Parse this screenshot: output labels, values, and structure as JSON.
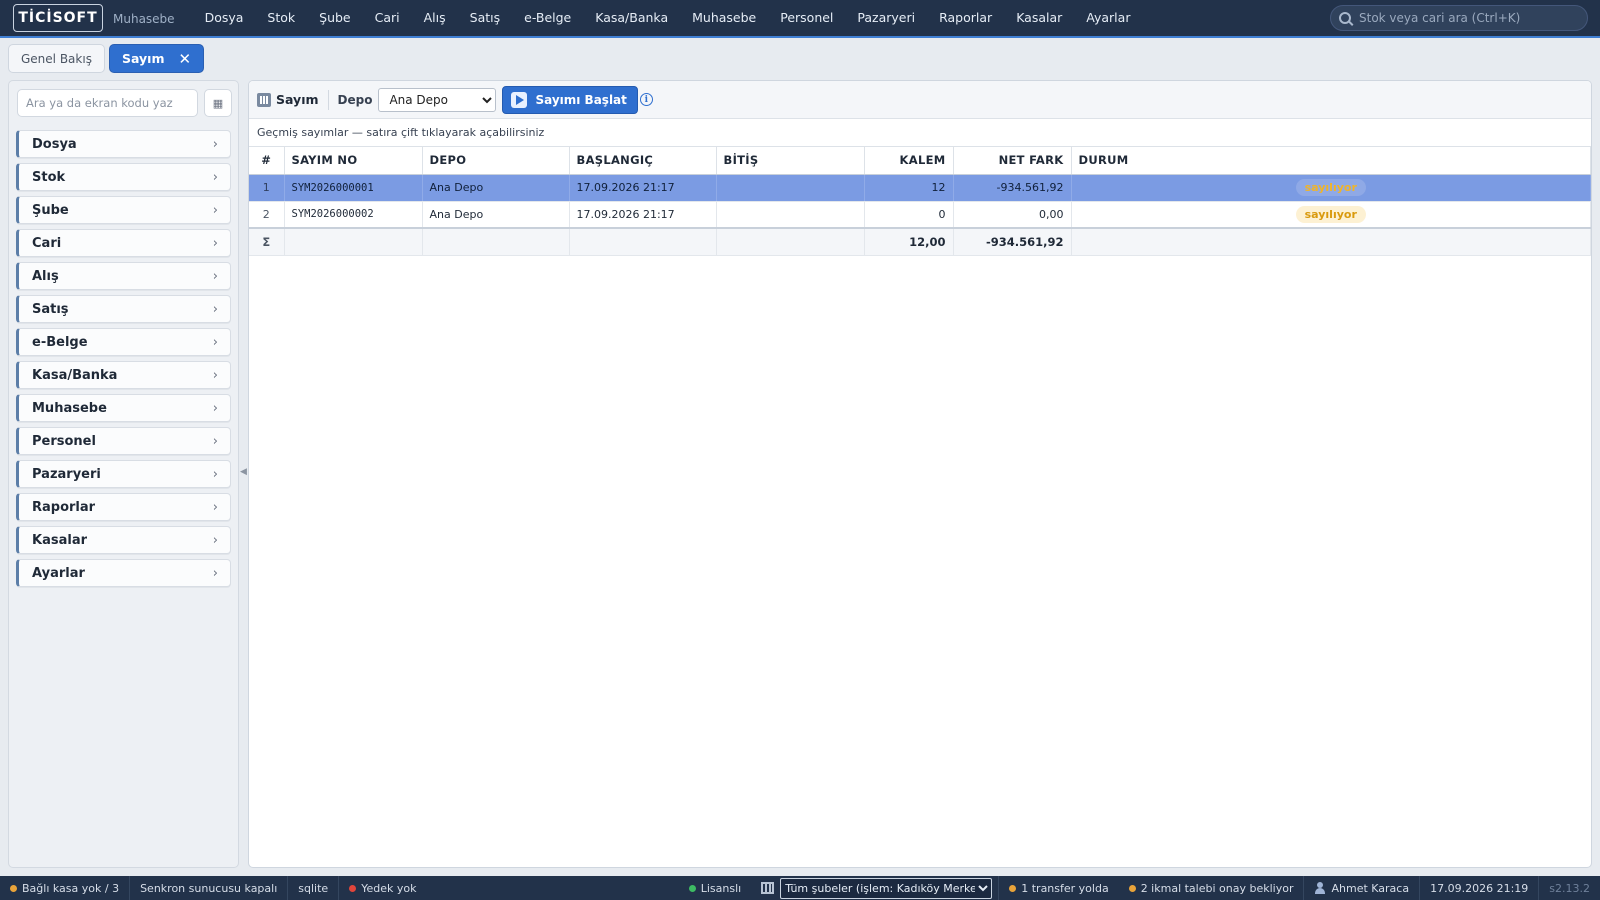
{
  "topbar": {
    "logo": "TİCİSOFT",
    "app_sub": "Muhasebe",
    "menu": [
      "Dosya",
      "Stok",
      "Şube",
      "Cari",
      "Alış",
      "Satış",
      "e-Belge",
      "Kasa/Banka",
      "Muhasebe",
      "Personel",
      "Pazaryeri",
      "Raporlar",
      "Kasalar",
      "Ayarlar"
    ],
    "search_placeholder": "Stok veya cari ara (Ctrl+K)"
  },
  "tabs": {
    "overview": "Genel Bakış",
    "active": "Sayım",
    "close": "✕"
  },
  "sidebar": {
    "search_placeholder": "Ara ya da ekran kodu yaz",
    "grid_btn": "▦",
    "items": [
      "Dosya",
      "Stok",
      "Şube",
      "Cari",
      "Alış",
      "Satış",
      "e-Belge",
      "Kasa/Banka",
      "Muhasebe",
      "Personel",
      "Pazaryeri",
      "Raporlar",
      "Kasalar",
      "Ayarlar"
    ],
    "chevron": "›",
    "collapse": "◀"
  },
  "toolbar": {
    "title": "Sayım",
    "depo_label": "Depo",
    "depo_selected": "Ana Depo",
    "start_label": "Sayımı Başlat",
    "info": "i"
  },
  "hint": "Geçmiş sayımlar — satıra çift tıklayarak açabilirsiniz",
  "table": {
    "columns": [
      "#",
      "SAYIM NO",
      "DEPO",
      "BAŞLANGIÇ",
      "BİTİŞ",
      "KALEM",
      "NET FARK",
      "DURUM"
    ],
    "rows": [
      {
        "idx": "1",
        "no": "SYM2026000001",
        "depo": "Ana Depo",
        "start": "17.09.2026 21:17",
        "end": "",
        "kalem": "12",
        "net": "-934.561,92",
        "status": "sayılıyor"
      },
      {
        "idx": "2",
        "no": "SYM2026000002",
        "depo": "Ana Depo",
        "start": "17.09.2026 21:17",
        "end": "",
        "kalem": "0",
        "net": "0,00",
        "status": "sayılıyor"
      }
    ],
    "total": {
      "sigma": "Σ",
      "kalem": "12,00",
      "net": "-934.561,92"
    }
  },
  "statusbar": {
    "kasa": "Bağlı kasa yok / 3",
    "sync": "Senkron sunucusu kapalı",
    "db": "sqlite",
    "backup": "Yedek yok",
    "license": "Lisanslı",
    "branch_selected": "Tüm şubeler (işlem: Kadıköy Merkez)",
    "transfer": "1 transfer yolda",
    "ikmal": "2 ikmal talebi onay bekliyor",
    "user": "Ahmet Karaca",
    "datetime": "17.09.2026 21:19",
    "version": "s2.13.2"
  },
  "colors": {
    "topbar": "#22324a",
    "accent": "#2f6fcf",
    "selected_row": "#7b9be3",
    "status_warn": "#d99a0e",
    "dot_orange": "#e8a33a",
    "dot_red": "#e0453b",
    "dot_green": "#3dbb63"
  }
}
